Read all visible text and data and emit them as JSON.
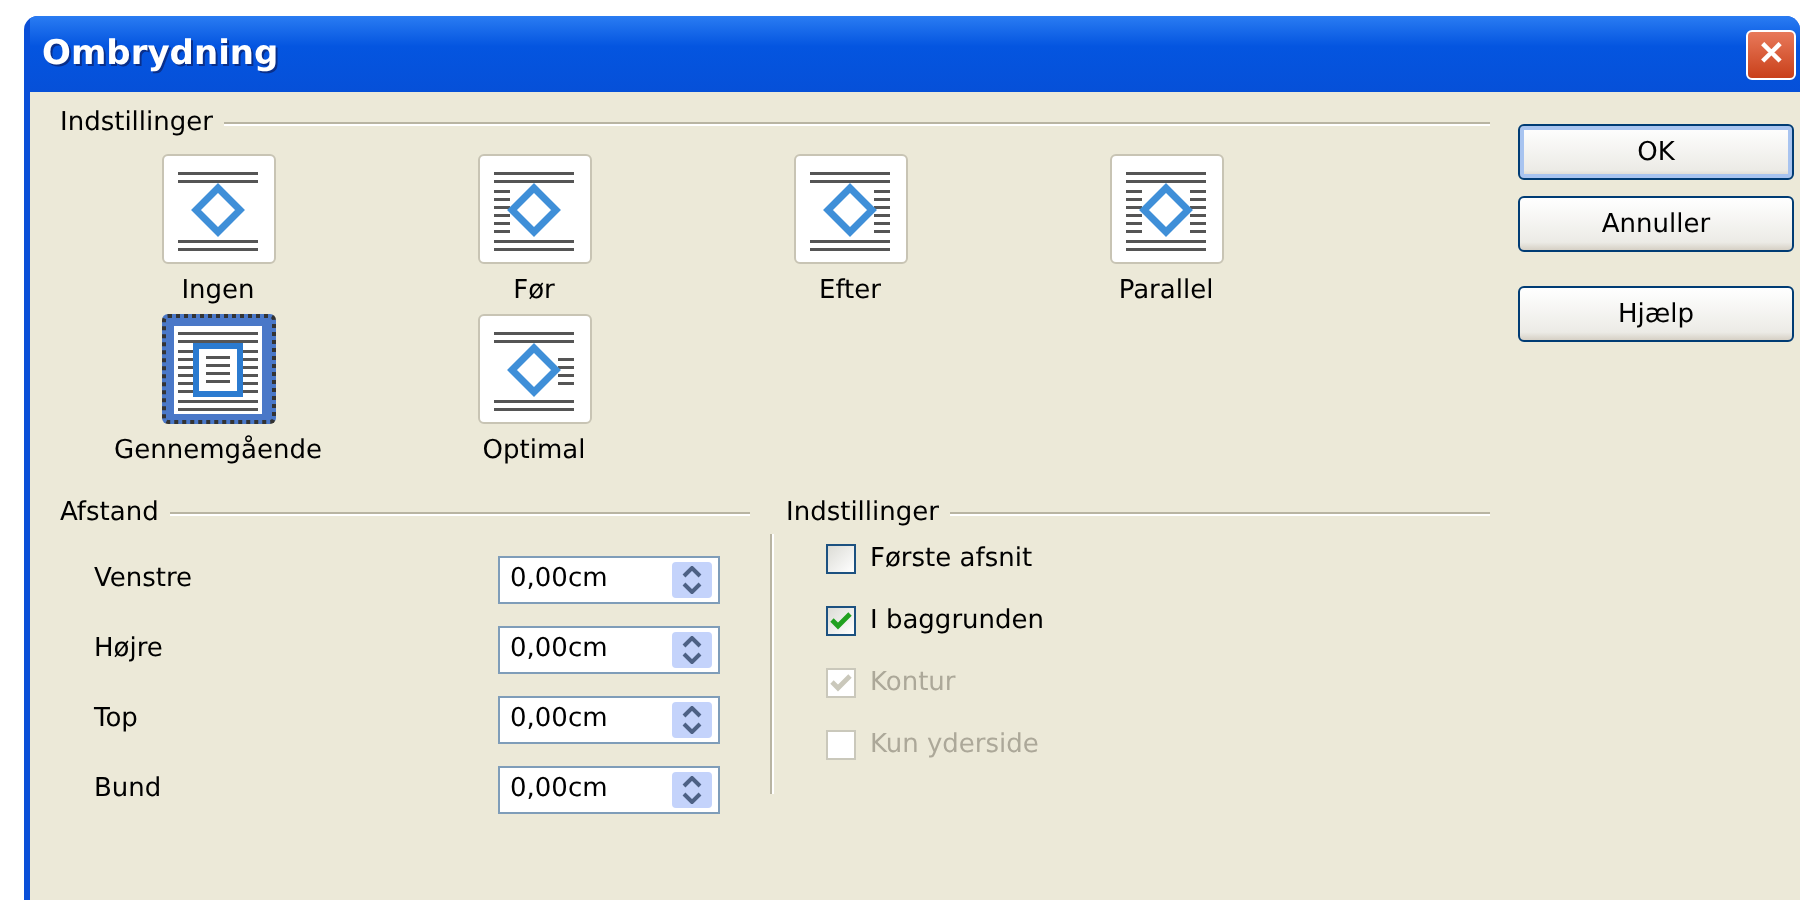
{
  "window": {
    "title": "Ombrydning",
    "close_label": "✕"
  },
  "wrap_settings": {
    "heading": "Indstillinger",
    "options": [
      {
        "kind": "none",
        "label": "Ingen",
        "selected": false
      },
      {
        "kind": "before",
        "label": "Før",
        "selected": false
      },
      {
        "kind": "after",
        "label": "Efter",
        "selected": false
      },
      {
        "kind": "parallel",
        "label": "Parallel",
        "selected": false
      },
      {
        "kind": "through",
        "label": "Gennemgående",
        "selected": true
      },
      {
        "kind": "optimal",
        "label": "Optimal",
        "selected": false
      }
    ]
  },
  "spacing": {
    "heading": "Afstand",
    "fields": [
      {
        "label": "Venstre",
        "value": "0,00cm"
      },
      {
        "label": "Højre",
        "value": "0,00cm"
      },
      {
        "label": "Top",
        "value": "0,00cm"
      },
      {
        "label": "Bund",
        "value": "0,00cm"
      }
    ]
  },
  "options": {
    "heading": "Indstillinger",
    "checkboxes": [
      {
        "label": "Første afsnit",
        "checked": false,
        "disabled": false
      },
      {
        "label": "I baggrunden",
        "checked": true,
        "disabled": false
      },
      {
        "label": "Kontur",
        "checked": true,
        "disabled": true
      },
      {
        "label": "Kun yderside",
        "checked": false,
        "disabled": true
      }
    ]
  },
  "buttons": [
    "OK",
    "Annuller",
    "Hjælp"
  ]
}
